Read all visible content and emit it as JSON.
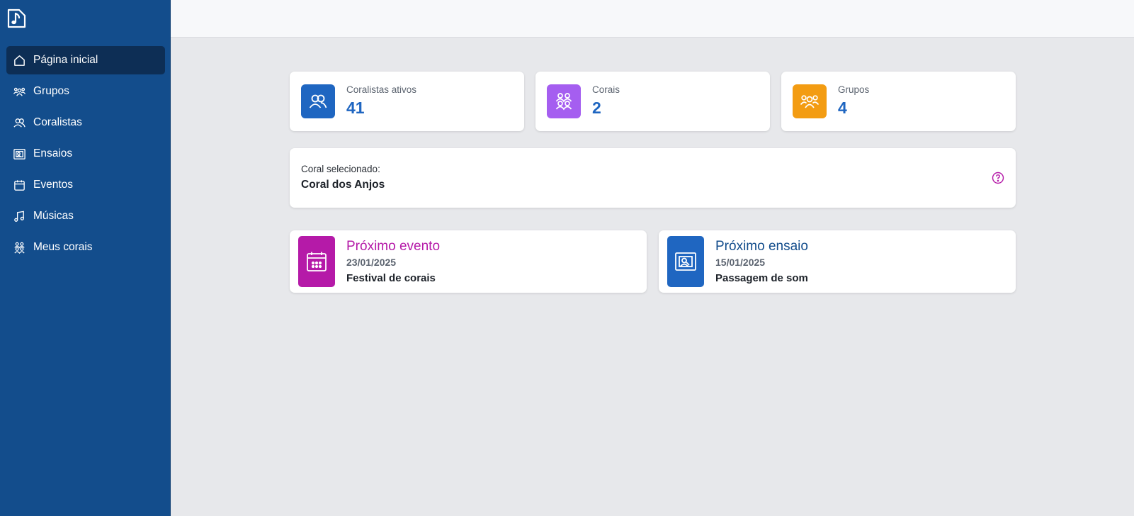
{
  "sidebar": {
    "logo": "music-note-icon",
    "items": [
      {
        "label": "Página inicial",
        "icon": "home-icon",
        "active": true
      },
      {
        "label": "Grupos",
        "icon": "groups-icon"
      },
      {
        "label": "Coralistas",
        "icon": "users-icon"
      },
      {
        "label": "Ensaios",
        "icon": "rehearsal-icon"
      },
      {
        "label": "Eventos",
        "icon": "calendar-icon"
      },
      {
        "label": "Músicas",
        "icon": "music-icon"
      },
      {
        "label": "Meus corais",
        "icon": "choirs-icon"
      }
    ]
  },
  "stats": [
    {
      "label": "Coralistas ativos",
      "value": "41",
      "color": "#1f66c1",
      "icon": "users-icon"
    },
    {
      "label": "Corais",
      "value": "2",
      "color": "#a55ef0",
      "icon": "choirs-icon"
    },
    {
      "label": "Grupos",
      "value": "4",
      "color": "#f39c12",
      "icon": "groups-icon"
    }
  ],
  "selected_coral": {
    "label": "Coral selecionado:",
    "value": "Coral dos Anjos",
    "help_icon": "help-circle-icon",
    "help_color": "#b51aa8"
  },
  "next_event": {
    "title": "Próximo evento",
    "date": "23/01/2025",
    "name": "Festival de corais",
    "color": "#b51aa8",
    "icon": "calendar-icon"
  },
  "next_rehearsal": {
    "title": "Próximo ensaio",
    "date": "15/01/2025",
    "name": "Passagem de som",
    "color": "#1f66c1",
    "title_color": "#134d8c",
    "icon": "rehearsal-icon"
  }
}
